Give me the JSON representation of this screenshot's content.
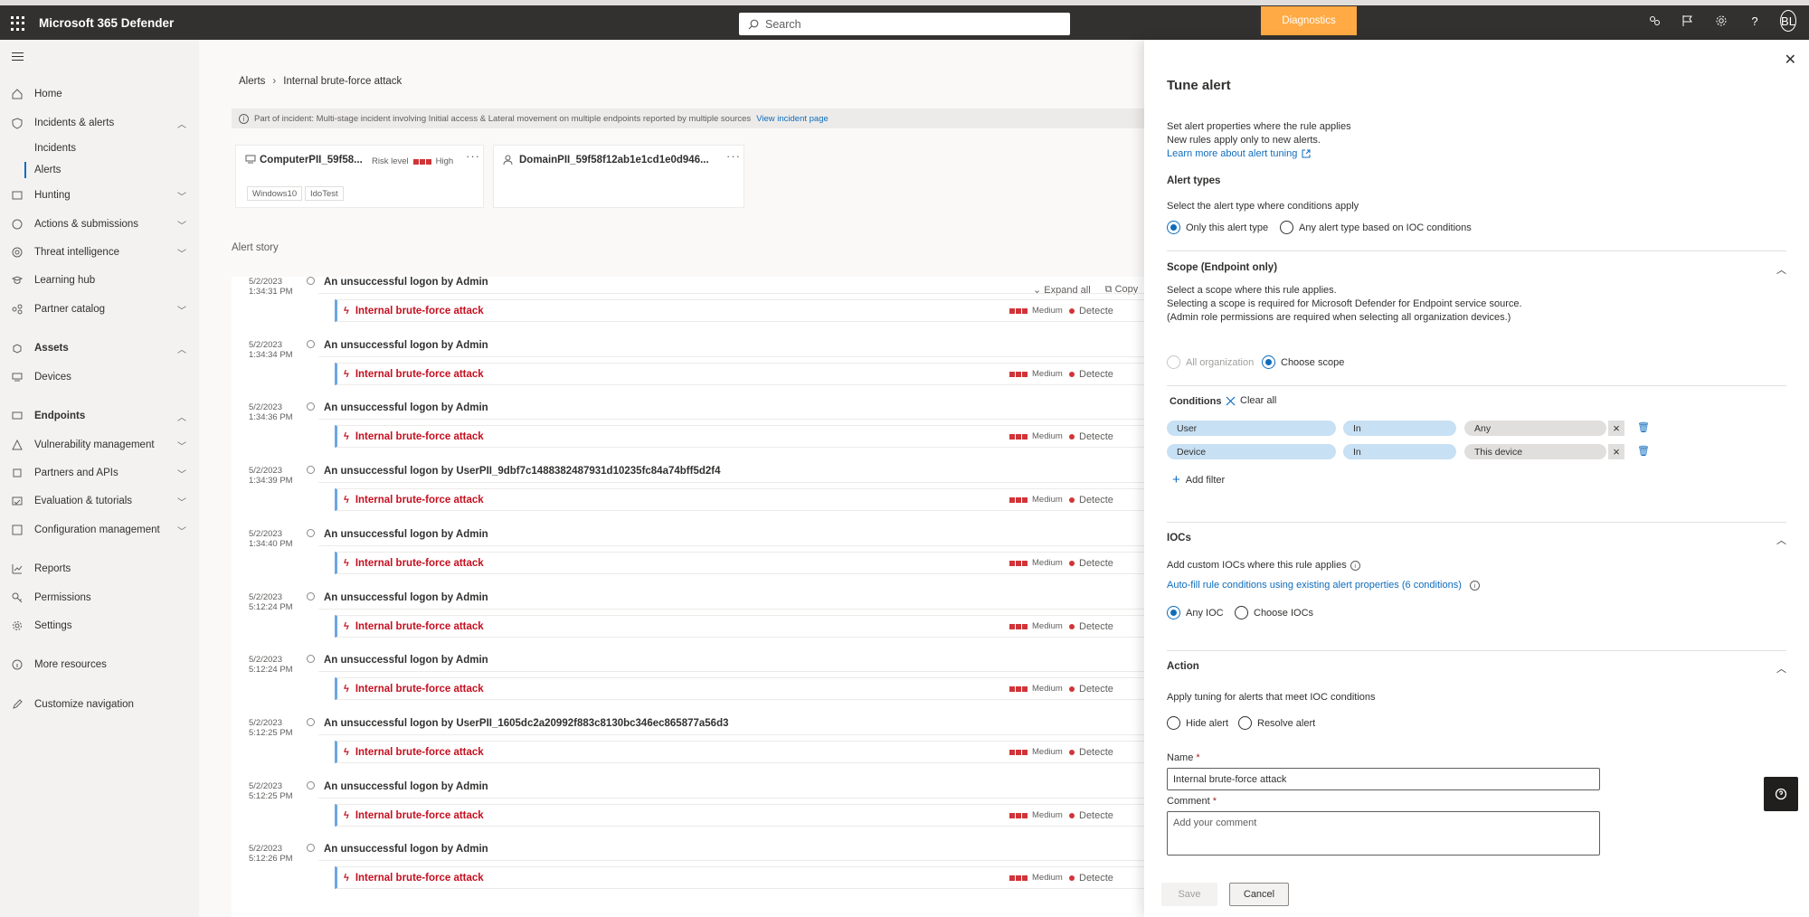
{
  "app": {
    "title": "Microsoft 365 Defender",
    "search_placeholder": "Search",
    "diagnostics_label": "Diagnostics",
    "avatar_initials": "BL"
  },
  "nav": {
    "items": [
      {
        "label": "Home"
      },
      {
        "label": "Incidents & alerts"
      },
      {
        "label": "Incidents"
      },
      {
        "label": "Alerts"
      },
      {
        "label": "Hunting"
      },
      {
        "label": "Actions & submissions"
      },
      {
        "label": "Threat intelligence"
      },
      {
        "label": "Learning hub"
      },
      {
        "label": "Partner catalog"
      },
      {
        "label": "Assets"
      },
      {
        "label": "Devices"
      },
      {
        "label": "Endpoints"
      },
      {
        "label": "Vulnerability management"
      },
      {
        "label": "Partners and APIs"
      },
      {
        "label": "Evaluation & tutorials"
      },
      {
        "label": "Configuration management"
      },
      {
        "label": "Reports"
      },
      {
        "label": "Permissions"
      },
      {
        "label": "Settings"
      },
      {
        "label": "More resources"
      },
      {
        "label": "Customize navigation"
      }
    ]
  },
  "breadcrumb": {
    "root": "Alerts",
    "current": "Internal brute-force attack"
  },
  "incident_bar": {
    "label": "Part of incident:",
    "text": "Multi-stage incident involving Initial access & Lateral movement on multiple endpoints reported by multiple sources",
    "link": "View incident page"
  },
  "cards": {
    "computer": {
      "title": "ComputerPII_59f58...",
      "risk_label": "Risk level",
      "risk_value": "High",
      "tags": [
        "Windows10",
        "IdoTest"
      ]
    },
    "domain": {
      "title": "DomainPII_59f58f12ab1e1cd1e0d946..."
    }
  },
  "story": {
    "title": "Alert story",
    "expand_all": "Expand all",
    "copy": "Copy",
    "rows": [
      {
        "date": "5/2/2023",
        "time": "1:34:31 PM",
        "event": "An unsuccessful logon by Admin",
        "alert": "Internal brute-force attack",
        "severity": "Medium",
        "status": "Detecte"
      },
      {
        "date": "5/2/2023",
        "time": "1:34:34 PM",
        "event": "An unsuccessful logon by Admin",
        "alert": "Internal brute-force attack",
        "severity": "Medium",
        "status": "Detecte"
      },
      {
        "date": "5/2/2023",
        "time": "1:34:36 PM",
        "event": "An unsuccessful logon by Admin",
        "alert": "Internal brute-force attack",
        "severity": "Medium",
        "status": "Detecte"
      },
      {
        "date": "5/2/2023",
        "time": "1:34:39 PM",
        "event": "An unsuccessful logon by UserPII_9dbf7c1488382487931d10235fc84a74bff5d2f4",
        "alert": "Internal brute-force attack",
        "severity": "Medium",
        "status": "Detecte"
      },
      {
        "date": "5/2/2023",
        "time": "1:34:40 PM",
        "event": "An unsuccessful logon by Admin",
        "alert": "Internal brute-force attack",
        "severity": "Medium",
        "status": "Detecte"
      },
      {
        "date": "5/2/2023",
        "time": "5:12:24 PM",
        "event": "An unsuccessful logon by Admin",
        "alert": "Internal brute-force attack",
        "severity": "Medium",
        "status": "Detecte"
      },
      {
        "date": "5/2/2023",
        "time": "5:12:24 PM",
        "event": "An unsuccessful logon by Admin",
        "alert": "Internal brute-force attack",
        "severity": "Medium",
        "status": "Detecte"
      },
      {
        "date": "5/2/2023",
        "time": "5:12:25 PM",
        "event": "An unsuccessful logon by UserPII_1605dc2a20992f883c8130bc346ec865877a56d3",
        "alert": "Internal brute-force attack",
        "severity": "Medium",
        "status": "Detecte"
      },
      {
        "date": "5/2/2023",
        "time": "5:12:25 PM",
        "event": "An unsuccessful logon by Admin",
        "alert": "Internal brute-force attack",
        "severity": "Medium",
        "status": "Detecte"
      },
      {
        "date": "5/2/2023",
        "time": "5:12:26 PM",
        "event": "An unsuccessful logon by Admin",
        "alert": "Internal brute-force attack",
        "severity": "Medium",
        "status": "Detecte"
      }
    ]
  },
  "panel": {
    "title": "Tune alert",
    "intro_1": "Set alert properties where the rule applies",
    "intro_2": "New rules apply only to new alerts.",
    "learn_more": "Learn more about alert tuning",
    "alert_types": {
      "heading": "Alert types",
      "desc": "Select the alert type where conditions apply",
      "opt1": "Only this alert type",
      "opt2": "Any alert type based on IOC conditions",
      "selected": "Only this alert type"
    },
    "scope": {
      "heading": "Scope (Endpoint only)",
      "desc1": "Select a scope where this rule applies.",
      "desc2": "Selecting a scope is required for Microsoft Defender for Endpoint service source.",
      "desc3": "(Admin role permissions are required when selecting all organization devices.)",
      "opt1": "All organization",
      "opt2": "Choose scope",
      "selected": "Choose scope"
    },
    "conditions": {
      "label": "Conditions",
      "clear_all": "Clear all",
      "rows": [
        {
          "field": "User",
          "operator": "In",
          "value": "Any"
        },
        {
          "field": "Device",
          "operator": "In",
          "value": "This device"
        }
      ],
      "add_filter": "Add filter"
    },
    "iocs": {
      "heading": "IOCs",
      "desc": "Add custom IOCs where this rule applies",
      "autofill": "Auto-fill rule conditions using existing alert properties (6 conditions)",
      "opt1": "Any IOC",
      "opt2": "Choose IOCs",
      "selected": "Any IOC"
    },
    "action": {
      "heading": "Action",
      "desc": "Apply tuning for alerts that meet IOC conditions",
      "opt1": "Hide alert",
      "opt2": "Resolve alert"
    },
    "name_label": "Name",
    "name_value": "Internal brute-force attack",
    "comment_label": "Comment",
    "comment_placeholder": "Add your comment",
    "required_mark": "*",
    "save": "Save",
    "cancel": "Cancel"
  },
  "colors": {
    "topbar": "#323130",
    "accent": "#0f6cbd",
    "diagnostics": "#ffaa44",
    "alert_red": "#c50f1f"
  }
}
